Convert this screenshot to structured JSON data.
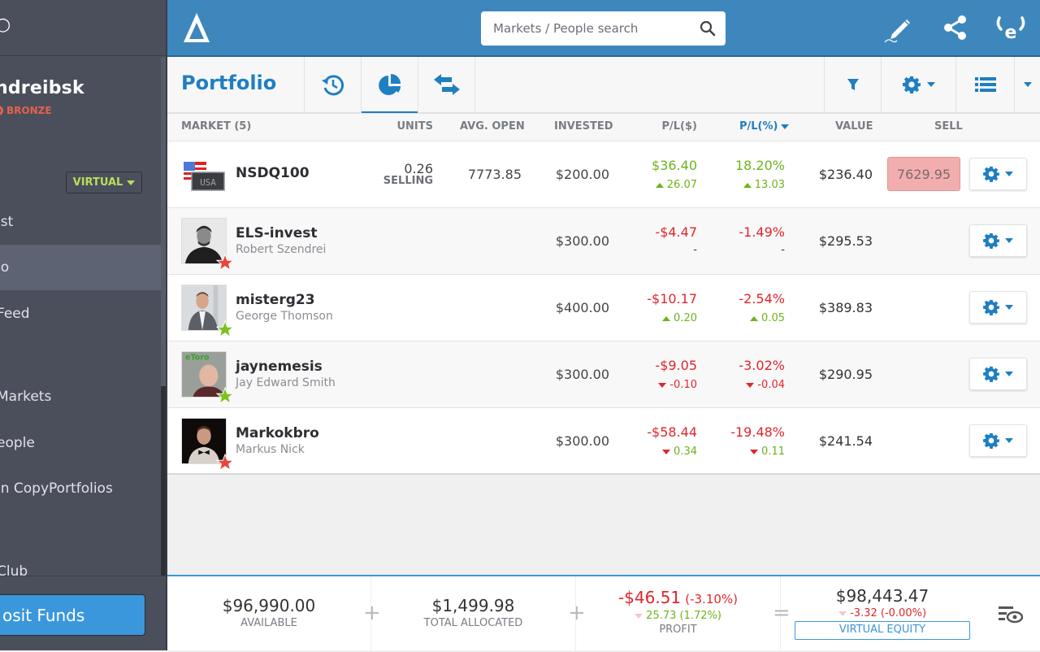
{
  "sidebar": {
    "username": "ndreibsk",
    "tier": "BRONZE",
    "mode_selector": "VIRTUAL",
    "nav_items": [
      {
        "label": "ist",
        "active": false
      },
      {
        "label": "io",
        "active": true
      },
      {
        "label": "Feed",
        "active": false
      },
      {
        "label": "Markets",
        "active": false
      },
      {
        "label": "eople",
        "active": false
      },
      {
        "label": "in CopyPortfolios",
        "active": false
      },
      {
        "label": "Club",
        "active": false
      }
    ],
    "deposit_label": "osit Funds"
  },
  "topbar": {
    "search_placeholder": "Markets / People search",
    "icons": [
      "pencil-signature-icon",
      "share-icon",
      "etoro-logo-icon"
    ]
  },
  "subbar": {
    "title": "Portfolio",
    "tabs": [
      {
        "icon": "history-icon",
        "active": false
      },
      {
        "icon": "pie-chart-icon",
        "active": true
      },
      {
        "icon": "transfer-arrows-icon",
        "active": false
      }
    ],
    "right_tools": [
      "filter-icon",
      "gear-icon",
      "list-view-icon",
      "chevron-down-icon"
    ]
  },
  "table": {
    "columns": {
      "market": "MARKET (5)",
      "units": "UNITS",
      "avg_open": "AVG. OPEN",
      "invested": "INVESTED",
      "pl_usd": "P/L($)",
      "pl_pct": "P/L(%)",
      "value": "VALUE",
      "sell": "SELL"
    },
    "rows": [
      {
        "type": "instrument",
        "name": "NSDQ100",
        "subtitle": "",
        "units": "0.26",
        "units_label": "SELLING",
        "avg_open": "7773.85",
        "invested": "$200.00",
        "pl_usd": "$36.40",
        "pl_usd_color": "green",
        "pl_usd_change": "26.07",
        "pl_usd_change_dir": "up",
        "pl_usd_change_color": "green",
        "pl_pct": "18.20%",
        "pl_pct_color": "green",
        "pl_pct_change": "13.03",
        "pl_pct_change_dir": "up",
        "pl_pct_change_color": "green",
        "value": "$236.40",
        "sell_rate": "7629.95"
      },
      {
        "type": "person",
        "name": "ELS-invest",
        "subtitle": "Robert Szendrei",
        "star": "red",
        "invested": "$300.00",
        "pl_usd": "-$4.47",
        "pl_usd_color": "red",
        "pl_usd_change": "-",
        "pl_usd_change_dir": "none",
        "pl_usd_change_color": "dark",
        "pl_pct": "-1.49%",
        "pl_pct_color": "red",
        "pl_pct_change": "-",
        "pl_pct_change_dir": "none",
        "pl_pct_change_color": "dark",
        "value": "$295.53"
      },
      {
        "type": "person",
        "name": "misterg23",
        "subtitle": "George Thomson",
        "star": "green",
        "invested": "$400.00",
        "pl_usd": "-$10.17",
        "pl_usd_color": "red",
        "pl_usd_change": "0.20",
        "pl_usd_change_dir": "up",
        "pl_usd_change_color": "green",
        "pl_pct": "-2.54%",
        "pl_pct_color": "red",
        "pl_pct_change": "0.05",
        "pl_pct_change_dir": "up",
        "pl_pct_change_color": "green",
        "value": "$389.83"
      },
      {
        "type": "person",
        "name": "jaynemesis",
        "subtitle": "Jay Edward Smith",
        "star": "green",
        "invested": "$300.00",
        "pl_usd": "-$9.05",
        "pl_usd_color": "red",
        "pl_usd_change": "-0.10",
        "pl_usd_change_dir": "down",
        "pl_usd_change_color": "red",
        "pl_pct": "-3.02%",
        "pl_pct_color": "red",
        "pl_pct_change": "-0.04",
        "pl_pct_change_dir": "down",
        "pl_pct_change_color": "red",
        "value": "$290.95"
      },
      {
        "type": "person",
        "name": "Markokbro",
        "subtitle": "Markus Nick",
        "star": "red",
        "invested": "$300.00",
        "pl_usd": "-$58.44",
        "pl_usd_color": "red",
        "pl_usd_change": "0.34",
        "pl_usd_change_dir": "down",
        "pl_usd_change_color": "green",
        "pl_pct": "-19.48%",
        "pl_pct_color": "red",
        "pl_pct_change": "0.11",
        "pl_pct_change_dir": "down",
        "pl_pct_change_color": "green",
        "value": "$241.54"
      }
    ]
  },
  "footer": {
    "available": {
      "value": "$96,990.00",
      "label": "AVAILABLE"
    },
    "allocated": {
      "value": "$1,499.98",
      "label": "TOTAL ALLOCATED"
    },
    "profit": {
      "value": "-$46.51",
      "pct": "(-3.10%)",
      "change": "25.73 (1.72%)",
      "label": "PROFIT"
    },
    "equity": {
      "value": "$98,443.47",
      "change": "-3.32 (-0.00%)",
      "label": "VIRTUAL EQUITY"
    },
    "operators": [
      "+",
      "+",
      "="
    ]
  },
  "colors": {
    "brand_blue": "#3d87bd",
    "accent_blue": "#1e7fc1",
    "positive": "#6db31b",
    "negative": "#e0262b",
    "sidebar": "#4b4f5c",
    "tier_bronze": "#e4624a",
    "virtual_green": "#b6df5a"
  }
}
